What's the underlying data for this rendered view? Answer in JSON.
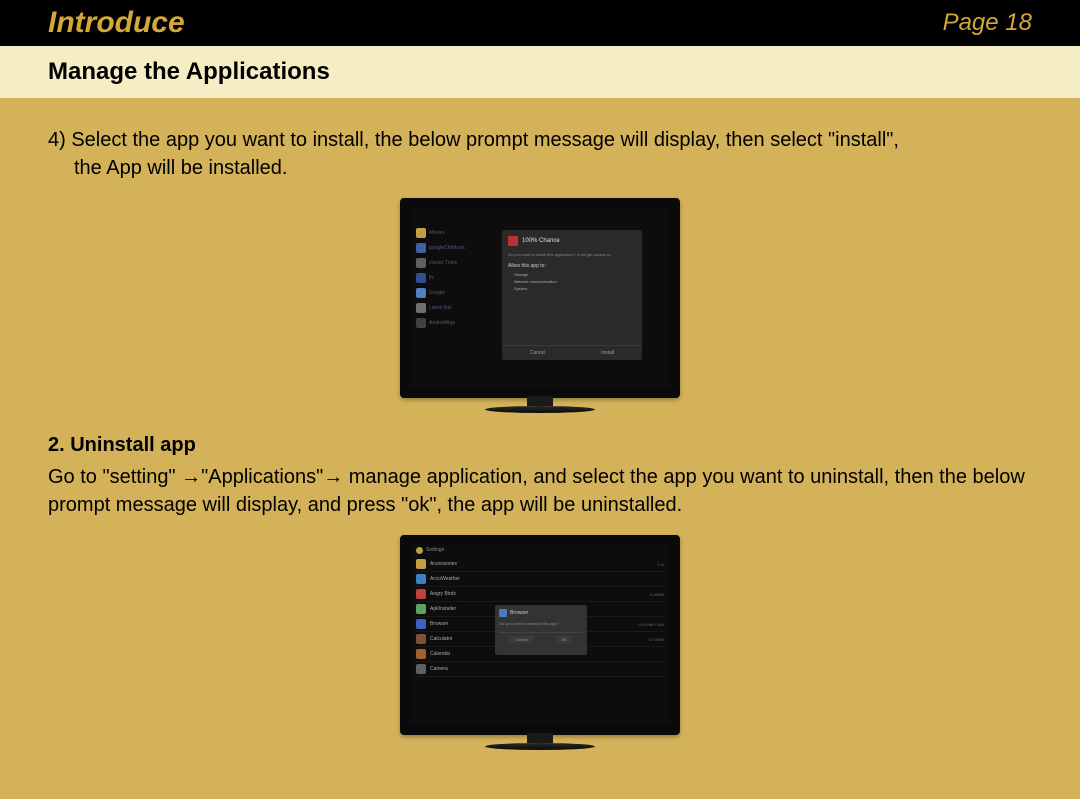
{
  "header": {
    "title": "Introduce",
    "page": "Page 18"
  },
  "subheader": {
    "title": "Manage the Applications"
  },
  "content": {
    "step4_line1": "4) Select the app you want to install, the below prompt message will display, then select \"install\",",
    "step4_line2": "the App will be installed.",
    "section2_heading": "2. Uninstall app",
    "section2_body": "Go to \"setting\" →\"Applications\"→ manage application, and select the app you want to uninstall, then the below prompt message will display, and press \"ok\", the app will be uninstalled."
  },
  "tv1": {
    "dialog_title": "100% Chance",
    "dialog_prompt": "Do you want to install this application? It will get access to:",
    "dialog_section": "Allow this app to:",
    "bullet1": "Storage",
    "bullet2": "Network communication",
    "bullet3": "System",
    "btn_cancel": "Cancel",
    "btn_install": "Install",
    "sidebar_items": [
      "Movies",
      "googleChrMusic",
      "classic Tetris",
      "flv",
      "Google",
      "Latest link",
      "AndroidApp"
    ]
  },
  "tv2": {
    "header": "Settings",
    "rows": [
      {
        "name": "Accessories",
        "right": "2 in"
      },
      {
        "name": "AccuWeather",
        "right": ""
      },
      {
        "name": "Angry Birds",
        "right": "6.93MB"
      },
      {
        "name": "ApkInstaller",
        "right": ""
      },
      {
        "name": "Browser",
        "right": "0.97MB/0.06B"
      },
      {
        "name": "Calculator",
        "right": "12.00KB"
      },
      {
        "name": "Calendar",
        "right": ""
      },
      {
        "name": "Camera",
        "right": ""
      }
    ],
    "dialog_title": "Browser",
    "dialog_text": "Do you want to uninstall this app?",
    "btn_cancel": "Cancel",
    "btn_ok": "OK"
  }
}
